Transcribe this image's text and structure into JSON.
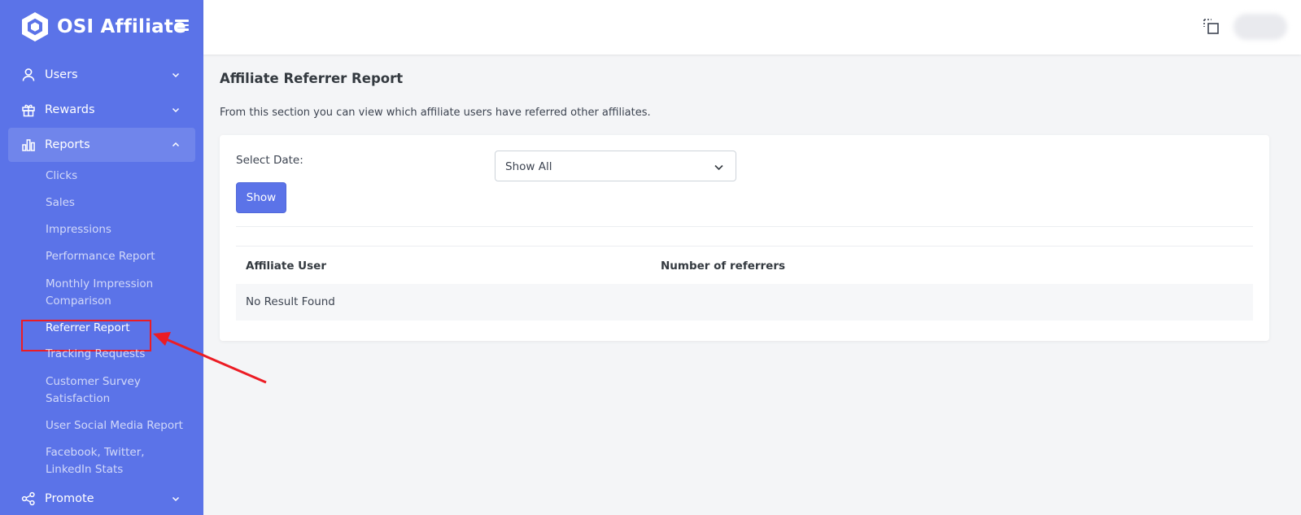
{
  "brand": {
    "name": "OSI Affiliate",
    "logo_icon": "hexagon-logo-icon",
    "menu_icon": "hamburger-icon"
  },
  "sidebar": {
    "nav": [
      {
        "label": "Users",
        "icon": "user-icon",
        "expanded": false
      },
      {
        "label": "Rewards",
        "icon": "gift-icon",
        "expanded": false
      },
      {
        "label": "Reports",
        "icon": "bar-chart-icon",
        "expanded": true
      },
      {
        "label": "Promote",
        "icon": "share-icon",
        "expanded": false
      }
    ],
    "report_items": [
      "Clicks",
      "Sales",
      "Impressions",
      "Performance Report",
      "Monthly Impression Comparison",
      "Referrer Report",
      "Tracking Requests",
      "Customer Survey Satisfaction",
      "User Social Media Report",
      "Facebook, Twitter, LinkedIn Stats"
    ],
    "active_item": "Referrer Report"
  },
  "topbar": {
    "fullscreen_icon": "fullscreen-icon"
  },
  "page": {
    "title": "Affiliate Referrer Report",
    "description": "From this section you can view which affiliate users have referred other affiliates."
  },
  "filter": {
    "label": "Select Date:",
    "selected": "Show All",
    "button": "Show"
  },
  "table": {
    "columns": [
      "Affiliate User",
      "Number of referrers"
    ],
    "empty_message": "No Result Found"
  },
  "colors": {
    "sidebar": "#5b73e8",
    "accent": "#5b73e8",
    "annotation": "#ec1c24"
  }
}
